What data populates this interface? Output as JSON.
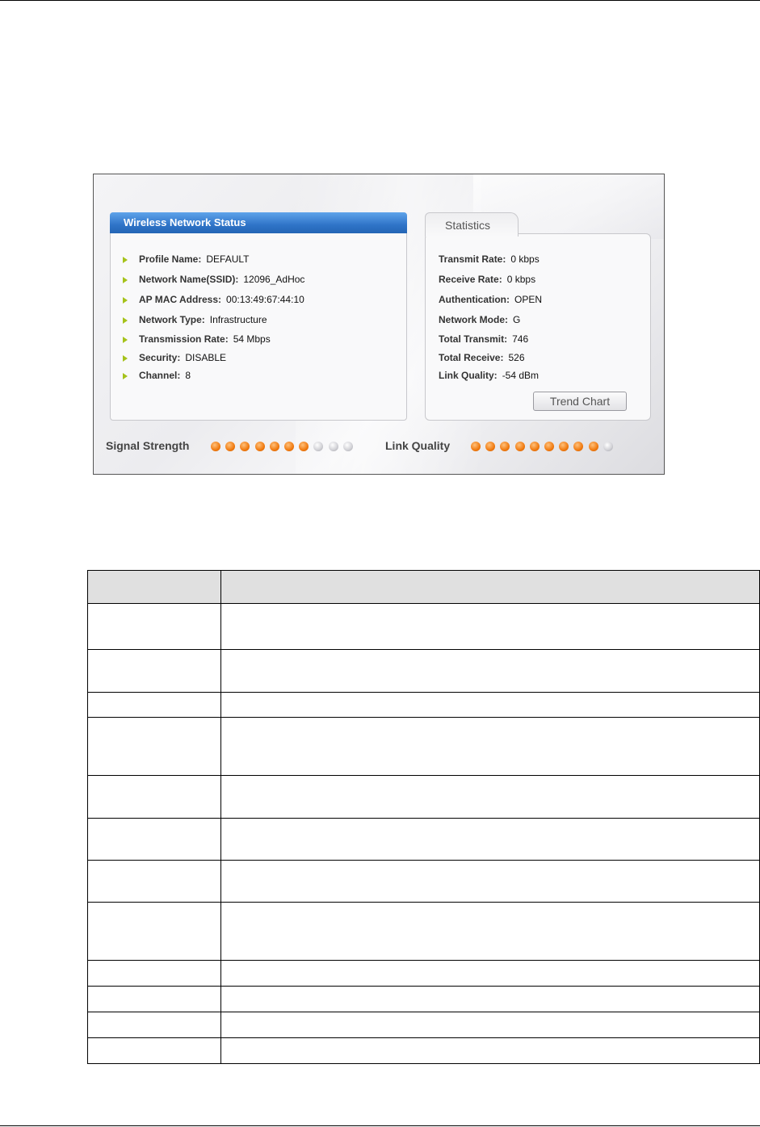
{
  "wireless_status": {
    "title": "Wireless Network Status",
    "rows": [
      {
        "label": "Profile Name:",
        "value": "DEFAULT"
      },
      {
        "label": "Network Name(SSID):",
        "value": "12096_AdHoc"
      },
      {
        "label": "AP MAC Address:",
        "value": "00:13:49:67:44:10"
      },
      {
        "label": "Network Type:",
        "value": "Infrastructure"
      },
      {
        "label": "Transmission Rate:",
        "value": "54 Mbps"
      },
      {
        "label": "Security:",
        "value": "DISABLE"
      },
      {
        "label": "Channel:",
        "value": "8"
      }
    ]
  },
  "statistics": {
    "tab_label": "Statistics",
    "rows": [
      {
        "label": "Transmit Rate:",
        "value": "0 kbps"
      },
      {
        "label": "Receive Rate:",
        "value": "0 kbps"
      },
      {
        "label": "Authentication:",
        "value": "OPEN"
      },
      {
        "label": "Network Mode:",
        "value": "G"
      },
      {
        "label": "Total Transmit:",
        "value": "746"
      },
      {
        "label": "Total Receive:",
        "value": "526"
      },
      {
        "label": "Link Quality:",
        "value": "-54 dBm"
      }
    ],
    "trend_button": "Trend Chart"
  },
  "meters": {
    "signal_label": "Signal Strength",
    "signal_level": 7,
    "signal_total": 10,
    "link_label": "Link Quality",
    "link_level": 9,
    "link_total": 10
  },
  "colors": {
    "accent": "#2f74c8",
    "bullet": "#a5c21a",
    "dot_on": "#f07a10"
  }
}
